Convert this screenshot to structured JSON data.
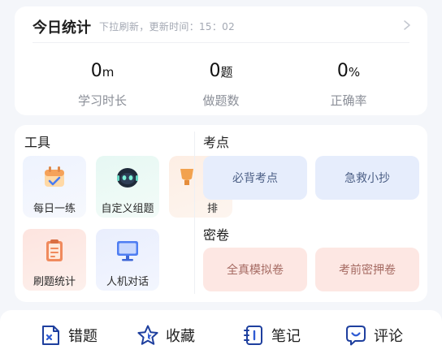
{
  "stats": {
    "title": "今日统计",
    "subtitle": "下拉刷新，更新时间：15：02",
    "items": [
      {
        "value": "0",
        "unit": "m",
        "label": "学习时长"
      },
      {
        "value": "0",
        "unit": "题",
        "label": "做题数"
      },
      {
        "value": "0",
        "unit": "%",
        "label": "正确率"
      }
    ]
  },
  "tools": {
    "title": "工具",
    "items": [
      {
        "label": "每日一练",
        "icon": "calendar-icon"
      },
      {
        "label": "自定义组题",
        "icon": "robot-icon"
      },
      {
        "label": "排",
        "icon": "ranking-icon"
      },
      {
        "label": "刷题统计",
        "icon": "clipboard-icon"
      },
      {
        "label": "人机对话",
        "icon": "monitor-icon"
      }
    ]
  },
  "kaodian": {
    "title": "考点",
    "items": [
      "必背考点",
      "急救小抄"
    ]
  },
  "mijuan": {
    "title": "密卷",
    "items": [
      "全真模拟卷",
      "考前密押卷"
    ]
  },
  "bottom_bar": {
    "items": [
      {
        "label": "错题",
        "icon": "wrong-question-icon"
      },
      {
        "label": "收藏",
        "icon": "star-icon"
      },
      {
        "label": "笔记",
        "icon": "notebook-icon"
      },
      {
        "label": "评论",
        "icon": "comment-icon"
      }
    ]
  },
  "colors": {
    "background": "#f4f6fa",
    "pill_blue": "#e6edfc",
    "pill_pink": "#fde7e3",
    "accent_blue": "#2f5bd3"
  }
}
